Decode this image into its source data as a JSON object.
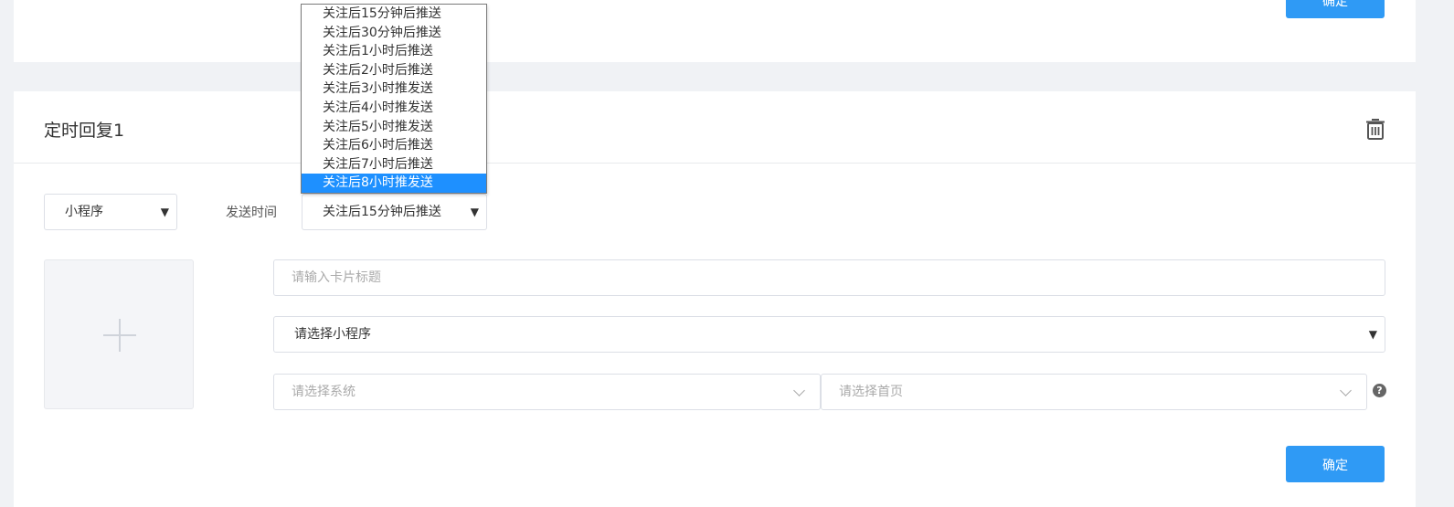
{
  "top_card": {
    "confirm_label": "确定"
  },
  "card": {
    "title": "定时回复1",
    "type_select": {
      "value": "小程序"
    },
    "send_time_label": "发送时间",
    "time_select": {
      "value": "关注后15分钟后推送"
    },
    "title_input": {
      "placeholder": "请输入卡片标题"
    },
    "miniprogram_select": {
      "value": "请选择小程序"
    },
    "system_select": {
      "placeholder": "请选择系统"
    },
    "home_select": {
      "placeholder": "请选择首页"
    },
    "confirm_label": "确定"
  },
  "dropdown": {
    "options": [
      "关注后15分钟后推送",
      "关注后30分钟后推送",
      "关注后1小时后推送",
      "关注后2小时后推送",
      "关注后3小时推发送",
      "关注后4小时推发送",
      "关注后5小时推发送",
      "关注后6小时后推送",
      "关注后7小时后推送",
      "关注后8小时推发送"
    ],
    "selected_index": 9
  },
  "icons": {
    "trash": "trash-icon",
    "chevron": "chevron-down-icon",
    "help": "question-circle-icon",
    "plus": "plus-icon"
  },
  "colors": {
    "primary": "#2f9af5",
    "selected_option": "#1e90ff"
  }
}
